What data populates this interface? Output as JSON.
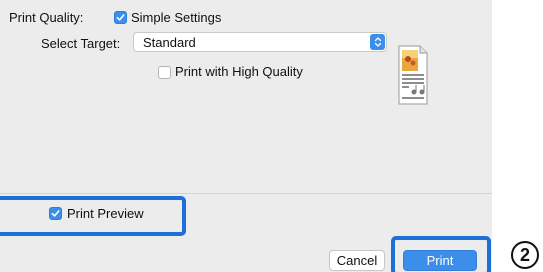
{
  "print_quality": {
    "label": "Print Quality:",
    "simple_settings": {
      "label": "Simple Settings",
      "checked": true
    }
  },
  "select_target": {
    "label": "Select Target:",
    "value": "Standard"
  },
  "high_quality": {
    "label": "Print with High Quality",
    "checked": false
  },
  "preview_icon": "paper-preview-icon",
  "print_preview": {
    "label": "Print Preview",
    "checked": true
  },
  "buttons": {
    "cancel_label": "Cancel",
    "print_label": "Print"
  },
  "step_marker": "2",
  "colors": {
    "accent": "#3b8eea",
    "highlight": "#1f6fd9",
    "dialog_bg": "#ececec"
  }
}
